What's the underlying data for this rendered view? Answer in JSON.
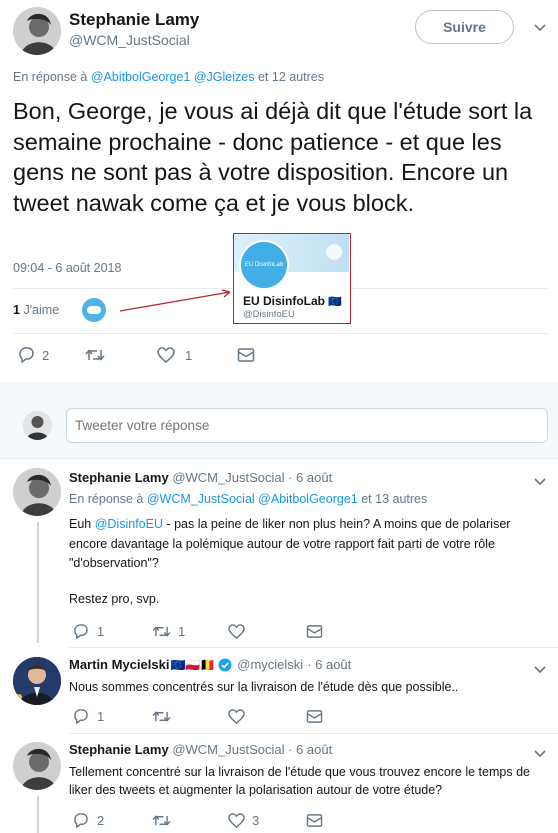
{
  "main_tweet": {
    "display_name": "Stephanie Lamy",
    "handle": "@WCM_JustSocial",
    "follow_label": "Suivre",
    "reply_prefix": "En réponse à",
    "reply_to": "@AbitbolGeorge1 @JGleizes",
    "reply_suffix": "et 12 autres",
    "text": "Bon, George, je vous ai déjà dit que l'étude sort la semaine prochaine - donc patience - et que les gens ne sont pas à votre disposition. Encore un tweet nawak come ça et je vous block.",
    "timestamp": "09:04 - 6 août 2018",
    "likes_count": "1",
    "likes_label": "J'aime",
    "reply_count": "2",
    "retweet_count": "",
    "like_count": "1"
  },
  "liker_card": {
    "avatar_text": "EU DisinfoLab",
    "name": "EU DisinfoLab",
    "flag": "🇪🇺",
    "handle": "@DisinfoEU"
  },
  "reply_box": {
    "placeholder": "Tweeter votre réponse"
  },
  "replies": [
    {
      "display_name": "Stephanie Lamy",
      "handle": "@WCM_JustSocial",
      "date": "· 6 août",
      "reply_prefix": "En réponse à",
      "reply_to": "@WCM_JustSocial @AbitbolGeorge1",
      "reply_suffix": "et 13 autres",
      "text_pre": "Euh ",
      "text_mention": "@DisinfoEU",
      "text_post": " - pas la peine de liker non plus hein? A moins que de polariser encore davantage la polémique autour de votre rapport fait parti de votre rôle \"d'observation\"?",
      "text2": "Restez pro, svp.",
      "reply_count": "1",
      "retweet_count": "1",
      "like_count": ""
    },
    {
      "display_name": "Martin Mycielski",
      "flags": "🇪🇺🇵🇱🇧🇪",
      "handle": "@mycielski",
      "date": "· 6 août",
      "text": "Nous sommes concentrés sur la livraison de l'étude dès que possible..",
      "reply_count": "1",
      "retweet_count": "",
      "like_count": ""
    },
    {
      "display_name": "Stephanie Lamy",
      "handle": "@WCM_JustSocial",
      "date": "· 6 août",
      "text": "Tellement concentré sur la livraison de l'étude que vous trouvez encore le temps de liker des tweets et augmenter la polarisation autour de votre étude?",
      "reply_count": "2",
      "retweet_count": "",
      "like_count": "3"
    }
  ],
  "colors": {
    "link": "#1b95e0",
    "muted": "#657786",
    "annotation_red": "#b0262b",
    "verified": "#1da1f2"
  },
  "icons": [
    "reply-icon",
    "retweet-icon",
    "like-icon",
    "dm-icon",
    "chevron-down-icon",
    "verified-icon"
  ]
}
